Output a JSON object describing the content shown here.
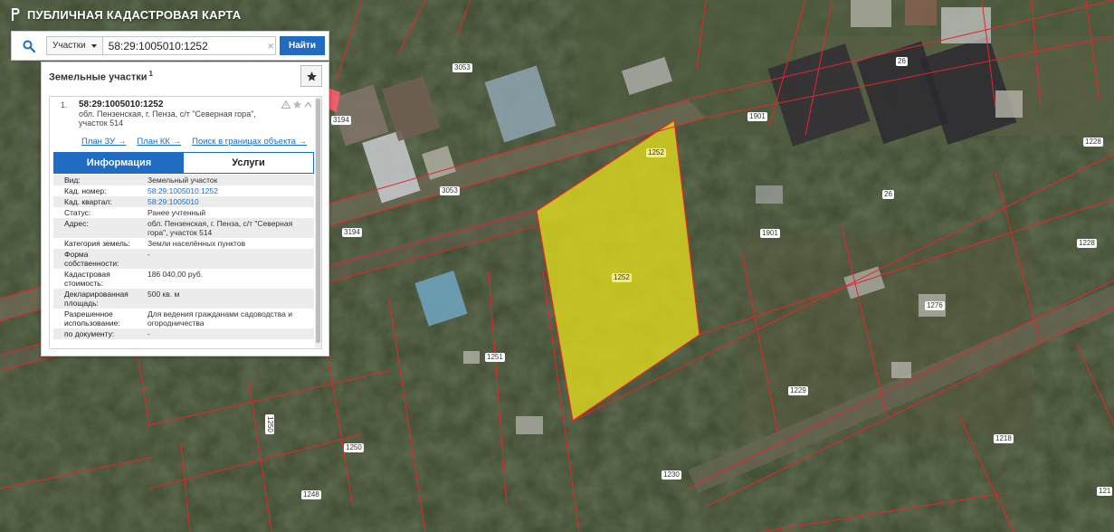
{
  "app": {
    "title": "ПУБЛИЧНАЯ КАДАСТРОВАЯ КАРТА"
  },
  "search": {
    "type_label": "Участки",
    "query": "58:29:1005010:1252",
    "find_label": "Найти",
    "clear_glyph": "×"
  },
  "panel": {
    "title": "Земельные участки",
    "count": "1",
    "result": {
      "index": "1.",
      "cad_number": "58:29:1005010:1252",
      "address": "обл. Пензенская, г. Пенза, с/т \"Северная гора\", участок 514",
      "links": [
        "План ЗУ →",
        "План КК →",
        "Поиск в границах объекта →"
      ]
    },
    "tabs": [
      {
        "label": "Информация",
        "active": true
      },
      {
        "label": "Услуги",
        "active": false
      }
    ],
    "rows": [
      {
        "key": "Вид:",
        "value": "Земельный участок"
      },
      {
        "key": "Кад. номер:",
        "value": "58:29:1005010:1252"
      },
      {
        "key": "Кад. квартал:",
        "value": "58:29:1005010"
      },
      {
        "key": "Статус:",
        "value": "Ранее учтенный"
      },
      {
        "key": "Адрес:",
        "value": "обл. Пензенская, г. Пенза, с/т \"Северная гора\", участок 514"
      },
      {
        "key": "Категория земель:",
        "value": "Земли населённых пунктов"
      },
      {
        "key": "Форма собственности:",
        "value": "-"
      },
      {
        "key": "Кадастровая стоимость:",
        "value": "186 040,00 руб."
      },
      {
        "key": "Декларированная площадь:",
        "value": "500 кв. м"
      },
      {
        "key": "Разрешенное использование:",
        "value": "Для ведения гражданами садоводства и огородничества"
      },
      {
        "key": "по документу:",
        "value": "-"
      }
    ]
  },
  "map": {
    "parcel_labels": [
      "3053",
      "3194",
      "3053",
      "3194",
      "26",
      "26",
      "1901",
      "1901",
      "1228",
      "1228",
      "1252",
      "1252",
      "1276",
      "1251",
      "1229",
      "1250",
      "1250",
      "1248",
      "1230",
      "1218",
      "121"
    ]
  },
  "colors": {
    "accent": "#1f6cc2",
    "parcel_border": "#e8242b",
    "selected_fill": "#e3dc1c"
  }
}
